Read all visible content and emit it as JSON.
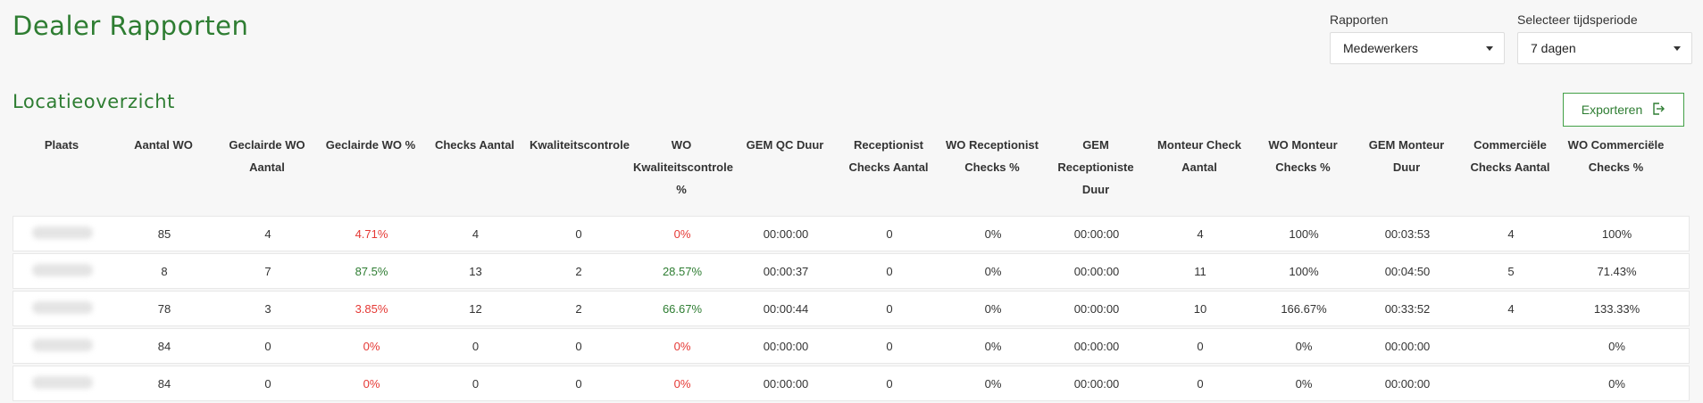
{
  "header": {
    "title": "Dealer Rapporten"
  },
  "filters": {
    "reports": {
      "label": "Rapporten",
      "value": "Medewerkers"
    },
    "period": {
      "label": "Selecteer tijdsperiode",
      "value": "7 dagen"
    }
  },
  "section": {
    "title": "Locatieoverzicht",
    "export_label": "Exporteren"
  },
  "table": {
    "headers": [
      "Plaats",
      "Aantal WO",
      "Geclairde WO Aantal",
      "Geclairde WO %",
      "Checks Aantal",
      "Kwaliteitscontrole",
      "WO Kwaliteitscontrole %",
      "GEM QC Duur",
      "Receptionist Checks Aantal",
      "WO Receptionist Checks %",
      "GEM Receptioniste Duur",
      "Monteur Check Aantal",
      "WO Monteur Checks %",
      "GEM Monteur Duur",
      "Commerciële Checks Aantal",
      "WO Commerciële Checks %"
    ],
    "rows": [
      [
        "",
        "85",
        "4",
        "4.71%",
        "4",
        "0",
        "0%",
        "00:00:00",
        "0",
        "0%",
        "00:00:00",
        "4",
        "100%",
        "00:03:53",
        "4",
        "100%"
      ],
      [
        "",
        "8",
        "7",
        "87.5%",
        "13",
        "2",
        "28.57%",
        "00:00:37",
        "0",
        "0%",
        "00:00:00",
        "11",
        "100%",
        "00:04:50",
        "5",
        "71.43%"
      ],
      [
        "",
        "78",
        "3",
        "3.85%",
        "12",
        "2",
        "66.67%",
        "00:00:44",
        "0",
        "0%",
        "00:00:00",
        "10",
        "166.67%",
        "00:33:52",
        "4",
        "133.33%"
      ],
      [
        "",
        "84",
        "0",
        "0%",
        "0",
        "0",
        "0%",
        "00:00:00",
        "0",
        "0%",
        "00:00:00",
        "0",
        "0%",
        "00:00:00",
        "",
        "0%"
      ],
      [
        "",
        "84",
        "0",
        "0%",
        "0",
        "0",
        "0%",
        "00:00:00",
        "0",
        "0%",
        "00:00:00",
        "0",
        "0%",
        "00:00:00",
        "",
        "0%"
      ]
    ],
    "row_colors": {
      "col3": [
        "red",
        "green",
        "red",
        "red",
        "red"
      ],
      "col6": [
        "red",
        "green",
        "green",
        "red",
        "red"
      ]
    }
  },
  "colors": {
    "accent": "#2e7d32",
    "negative": "#e53935",
    "positive": "#2e7d32"
  }
}
